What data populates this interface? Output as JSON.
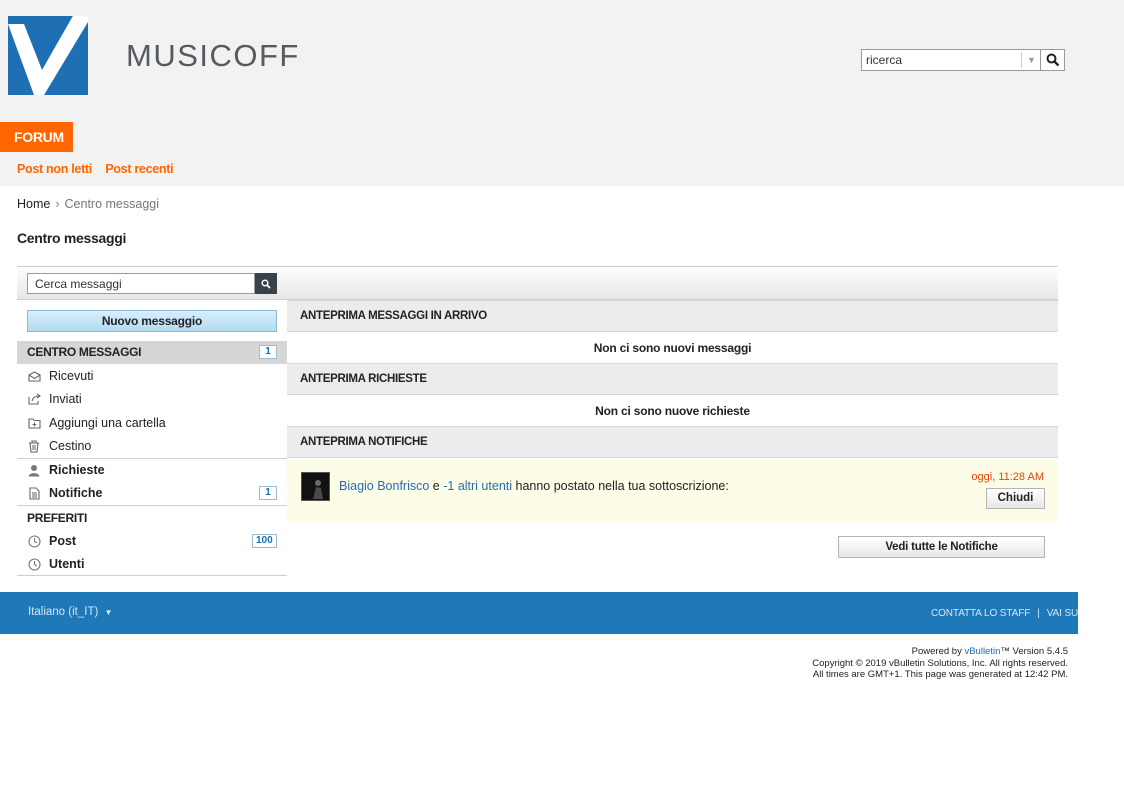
{
  "header": {
    "logo_text": "MUSICOFF",
    "search_value": "ricerca",
    "forum_tab": "FORUM",
    "subnav": [
      "Post non letti",
      "Post recenti"
    ]
  },
  "breadcrumb": {
    "home": "Home",
    "separator": "›",
    "current": "Centro messaggi"
  },
  "page_title": "Centro messaggi",
  "toolbar": {
    "search_value": "Cerca messaggi"
  },
  "sidebar": {
    "new_message_button": "Nuovo messaggio",
    "message_center": {
      "label": "CENTRO MESSAGGI",
      "count": "1"
    },
    "folders": [
      {
        "label": "Ricevuti",
        "icon": "inbox-icon"
      },
      {
        "label": "Inviati",
        "icon": "sent-icon"
      },
      {
        "label": "Aggiungi una cartella",
        "icon": "add-folder-icon"
      },
      {
        "label": "Cestino",
        "icon": "trash-icon"
      }
    ],
    "requests": {
      "label": "Richieste",
      "icon": "user-icon"
    },
    "notifications": {
      "label": "Notifiche",
      "count": "1",
      "icon": "document-icon"
    },
    "favorites": {
      "label": "PREFERITI",
      "posts": {
        "label": "Post",
        "count": "100",
        "icon": "clock-icon"
      },
      "users": {
        "label": "Utenti",
        "icon": "clock-icon"
      }
    }
  },
  "content": {
    "inbox_preview": {
      "title": "ANTEPRIMA MESSAGGI IN ARRIVO",
      "empty": "Non ci sono nuovi messaggi"
    },
    "requests_preview": {
      "title": "ANTEPRIMA RICHIESTE",
      "empty": "Non ci sono nuove richieste"
    },
    "notifications_preview": {
      "title": "ANTEPRIMA NOTIFICHE",
      "item": {
        "user": "Biagio Bonfrisco",
        "conj": " e ",
        "others": "-1 altri utenti",
        "text": " hanno postato nella tua sottoscrizione:",
        "time": "oggi, 11:28 AM",
        "close": "Chiudi"
      },
      "see_all": "Vedi tutte le Notifiche"
    }
  },
  "footer": {
    "language": "Italiano (it_IT)",
    "contact": "CONTATTA LO STAFF",
    "separator": "|",
    "go_up": "VAI SU",
    "powered_prefix": "Powered by ",
    "powered_brand": "vBulletin",
    "powered_suffix": "™ Version 5.4.5",
    "copyright": "Copyright © 2019 vBulletin Solutions, Inc. All rights reserved.",
    "times": "All times are GMT+1. This page was generated at 12:42 PM."
  },
  "colors": {
    "accent": "#ff6600",
    "footer": "#1f78b8",
    "link": "#1d6fb5",
    "logo": "#1d6fb5"
  }
}
